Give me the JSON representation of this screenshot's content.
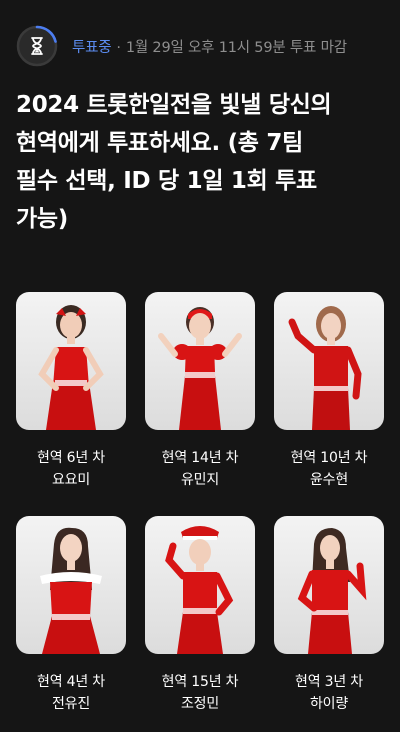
{
  "status": {
    "icon": "hourglass-icon",
    "badge": "투표중",
    "separator": "·",
    "deadline": "1월 29일 오후 11시 59분 투표 마감",
    "badge_color": "#5b8cf0",
    "ring_color": "#4c7df0"
  },
  "title": {
    "line1": "2024 트롯한일전을 빛낼 당신의",
    "line2": "현역에게 투표하세요. (총 7팀",
    "line3": "필수 선택, ID 당 1일 1회 투표",
    "line4": "가능)"
  },
  "candidates": [
    {
      "career": "현역 6년 차",
      "name": "요요미"
    },
    {
      "career": "현역 14년 차",
      "name": "유민지"
    },
    {
      "career": "현역 10년 차",
      "name": "윤수현"
    },
    {
      "career": "현역 4년 차",
      "name": "전유진"
    },
    {
      "career": "현역 15년 차",
      "name": "조정민"
    },
    {
      "career": "현역 3년 차",
      "name": "하이량"
    }
  ]
}
